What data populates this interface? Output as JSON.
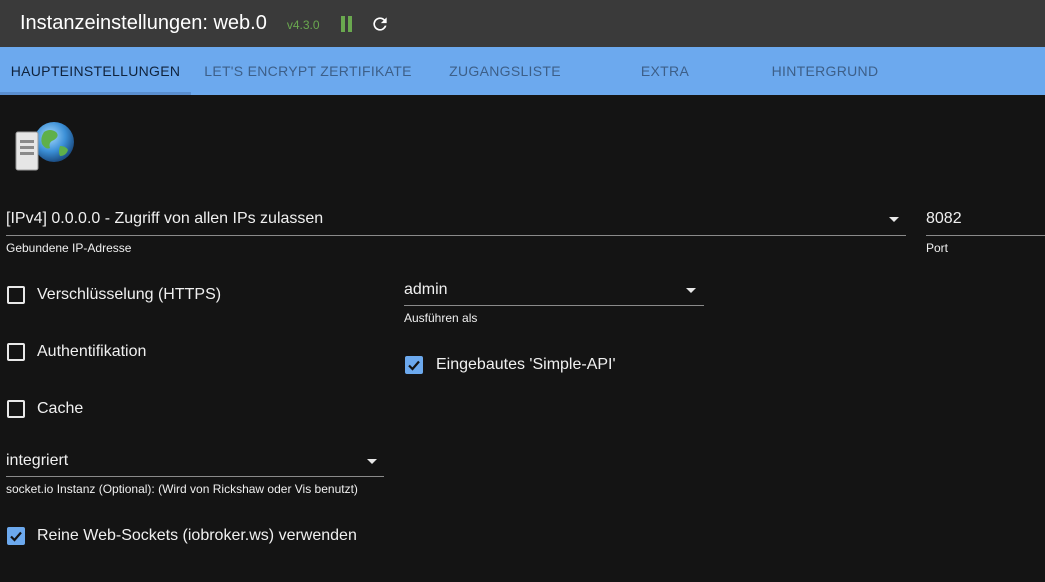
{
  "header": {
    "title": "Instanzeinstellungen: web.0",
    "version": "v4.3.0"
  },
  "tabs": [
    {
      "label": "HAUPTEINSTELLUNGEN",
      "active": true
    },
    {
      "label": "LET'S ENCRYPT ZERTIFIKATE",
      "active": false
    },
    {
      "label": "ZUGANGSLISTE",
      "active": false
    },
    {
      "label": "EXTRA",
      "active": false
    },
    {
      "label": "HINTERGRUND",
      "active": false
    }
  ],
  "bind": {
    "value": "[IPv4] 0.0.0.0 - Zugriff von allen IPs zulassen",
    "label": "Gebundene IP-Adresse"
  },
  "port": {
    "value": "8082",
    "label": "Port"
  },
  "checkboxes": {
    "https": {
      "label": "Verschlüsselung (HTTPS)",
      "checked": false
    },
    "auth": {
      "label": "Authentifikation",
      "checked": false
    },
    "cache": {
      "label": "Cache",
      "checked": false
    },
    "simple_api": {
      "label": "Eingebautes 'Simple-API'",
      "checked": true
    },
    "pure_ws": {
      "label": "Reine Web-Sockets (iobroker.ws) verwenden",
      "checked": true
    }
  },
  "run_as": {
    "value": "admin",
    "label": "Ausführen als"
  },
  "socketio": {
    "value": "integriert",
    "label": "socket.io Instanz (Optional): (Wird von Rickshaw oder Vis benutzt)"
  },
  "colors": {
    "accent": "#6ca9ee",
    "status_green": "#6aa84f",
    "background": "#141414"
  }
}
